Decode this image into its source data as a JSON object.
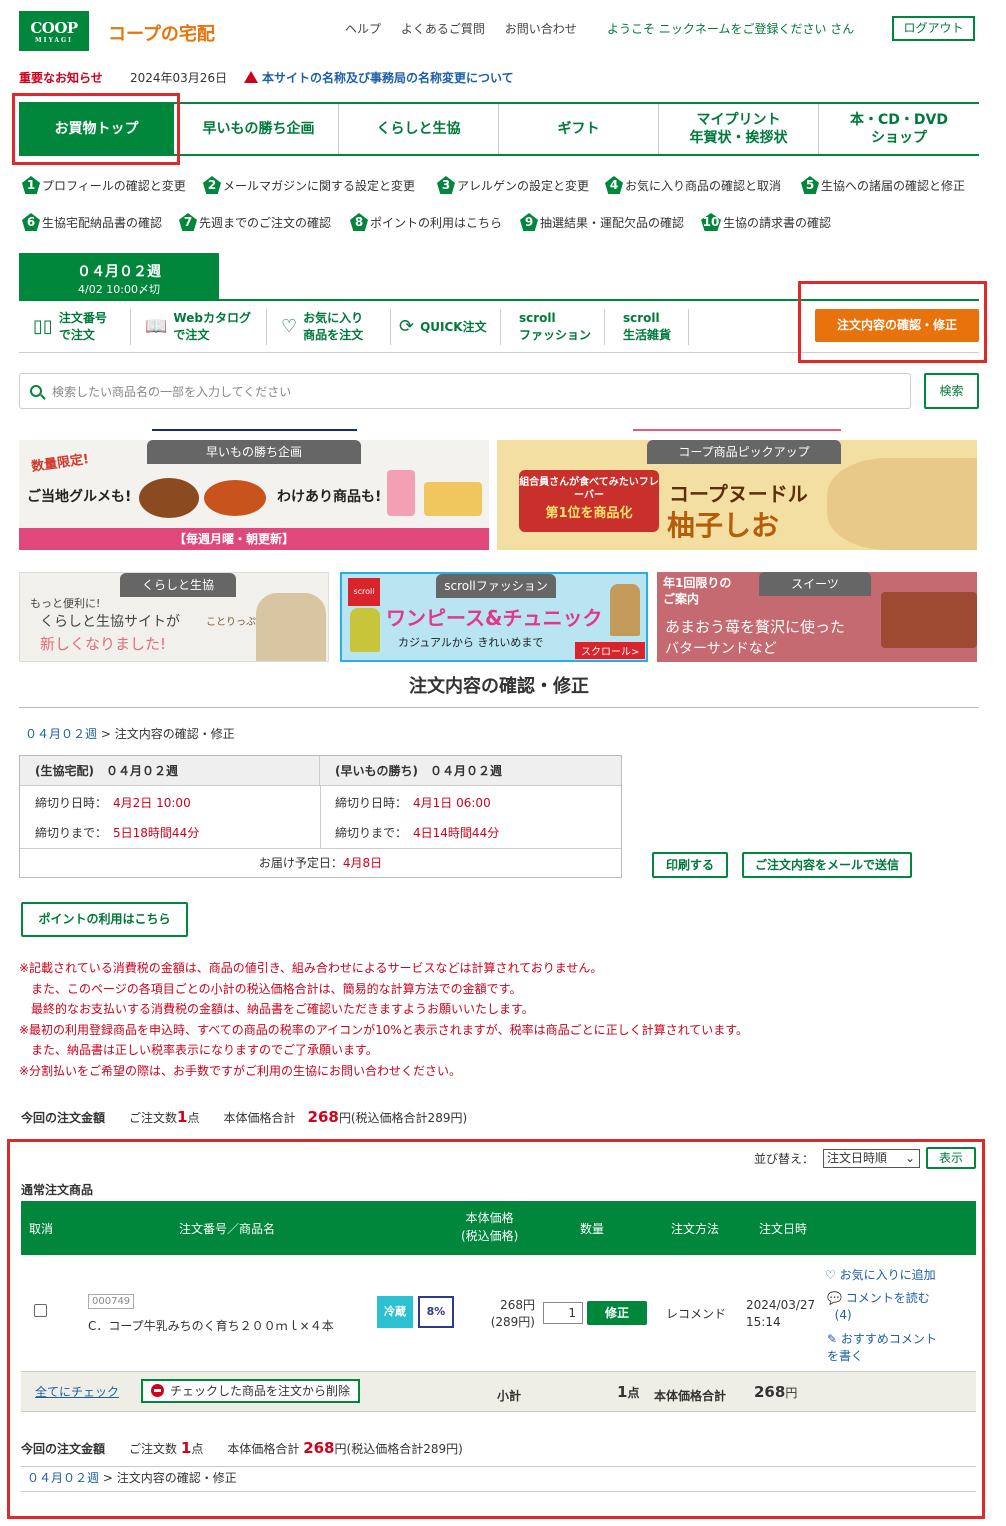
{
  "header": {
    "logo": "COOP",
    "logo_sub": "MIYAGI",
    "brand": "コープの宅配",
    "links": [
      "ヘルプ",
      "よくあるご質問",
      "お問い合わせ"
    ],
    "welcome": "ようこそ ニックネームをご登録ください さん",
    "logout": "ログアウト"
  },
  "notice": {
    "label": "重要なお知らせ",
    "date": "2024年03月26日",
    "link": "本サイトの名称及び事務局の名称変更について"
  },
  "nav": [
    {
      "label": "お買物トップ",
      "active": true
    },
    {
      "label": "早いもの勝ち企画"
    },
    {
      "label": "くらしと生協"
    },
    {
      "label": "ギフト"
    },
    {
      "label": "マイプリント",
      "label2": "年賀状・挨拶状"
    },
    {
      "label": "本・CD・DVD",
      "label2": "ショップ"
    }
  ],
  "profile_links": [
    {
      "n": "1",
      "label": "プロフィールの確認と変更"
    },
    {
      "n": "2",
      "label": "メールマガジンに関する設定と変更"
    },
    {
      "n": "3",
      "label": "アレルゲンの設定と変更"
    },
    {
      "n": "4",
      "label": "お気に入り商品の確認と取消"
    },
    {
      "n": "5",
      "label": "生協への諸届の確認と修正"
    },
    {
      "n": "6",
      "label": "生協宅配納品書の確認"
    },
    {
      "n": "7",
      "label": "先週までのご注文の確認"
    },
    {
      "n": "8",
      "label": "ポイントの利用はこちら"
    },
    {
      "n": "9",
      "label": "抽選結果・運配欠品の確認"
    },
    {
      "n": "10",
      "label": "生協の請求書の確認"
    }
  ],
  "week": {
    "title": "０４月０２週",
    "deadline": "4/02 10:00〆切"
  },
  "subnav": [
    {
      "icon": "book-icon",
      "label": "注文番号",
      "label2": "で注文"
    },
    {
      "icon": "catalog-icon",
      "label": "Webカタログ",
      "label2": "で注文"
    },
    {
      "icon": "heart-icon",
      "label": "お気に入り",
      "label2": "商品を注文"
    },
    {
      "icon": "refresh-icon",
      "label": "QUICK注文",
      "label2": ""
    },
    {
      "icon": "",
      "label": "scroll",
      "label2": "ファッション"
    },
    {
      "icon": "",
      "label": "scroll",
      "label2": "生活雑貨"
    }
  ],
  "order_check_button": "注文内容の確認・修正",
  "search": {
    "placeholder": "検索したい商品名の一部を入力してください",
    "button": "検索"
  },
  "banners": {
    "b1": {
      "tag": "早いもの勝ち企画",
      "t1": "数量限定!",
      "t2": "ご当地グルメも!",
      "t3": "わけあり商品も!",
      "foot": "【毎週月曜・朝更新】"
    },
    "b2": {
      "tag": "コープ商品ピックアップ",
      "t1": "組合員さんが食べてみたいフレーバー",
      "t2": "第1位を商品化",
      "t3": "コープヌードル",
      "t4": "柚子しお"
    },
    "b3": {
      "tag": "くらしと生協",
      "t1": "もっと便利に!",
      "t2": "くらしと生協サイトが",
      "t3": "新しくなりました!",
      "t4": "ことりっぷコラボ"
    },
    "b4": {
      "tag": "scrollファッション",
      "t1": "ワンピース&チュニック",
      "t2": "カジュアルから きれいめまで",
      "t3": "スクロール>"
    },
    "b5": {
      "tag": "スイーツ",
      "t1": "年1回限りの",
      "t2": "ご案内",
      "t3": "あまおう苺を贅沢に使った",
      "t4": "バターサンドなど"
    }
  },
  "page_title": "注文内容の確認・修正",
  "breadcrumb": {
    "week": "０４月０２週",
    "sep": " > ",
    "current": "注文内容の確認・修正"
  },
  "order_summary": {
    "left": {
      "head": "(生協宅配)　０４月０２週",
      "l1": "締切り日時：",
      "v1": "4月2日 10:00",
      "l2": "締切りまで：",
      "v2": "5日18時間44分"
    },
    "right": {
      "head": "(早いもの勝ち)　０４月０２週",
      "l1": "締切り日時：",
      "v1": "4月1日 06:00",
      "l2": "締切りまで：",
      "v2": "4日14時間44分"
    },
    "delivery_label": "お届け予定日：",
    "delivery_value": "4月8日"
  },
  "print_button": "印刷する",
  "mail_button": "ご注文内容をメールで送信",
  "points_button": "ポイントの利用はこちら",
  "notes": [
    "※記載されている消費税の金額は、商品の値引き、組み合わせによるサービスなどは計算されておりません。",
    "　また、このページの各項目ごとの小計の税込価格合計は、簡易的な計算方法での金額です。",
    "　最終的なお支払いする消費税の金額は、納品書をご確認いただきますようお願いいたします。",
    "※最初の利用登録商品を申込時、すべての商品の税率のアイコンが10%と表示されますが、税率は商品ごとに正しく計算されています。",
    "　また、納品書は正しい税率表示になりますのでご了承願います。",
    "※分割払いをご希望の際は、お手数ですがご利用の生協にお問い合わせください。"
  ],
  "total": {
    "label": "今回の注文金額",
    "count_label": "ご注文数",
    "count": "1",
    "count_unit": "点",
    "price_label": "本体価格合計",
    "price": "268",
    "price_unit": "円",
    "tax_note": "(税込価格合計289円)"
  },
  "sort": {
    "label": "並び替え：",
    "selected": "注文日時順",
    "button": "表示"
  },
  "section_title": "通常注文商品",
  "table": {
    "headers": {
      "cancel": "取消",
      "name": "注文番号／商品名",
      "price": "本体価格",
      "price2": "(税込価格)",
      "qty": "数量",
      "method": "注文方法",
      "date": "注文日時"
    },
    "rows": [
      {
        "code": "000749",
        "name": "C．コープ牛乳みちのく育ち２００ｍｌ×４本",
        "tag_cold": "冷蔵",
        "tag_tax": "8%",
        "price": "268円",
        "price_tax": "(289円)",
        "qty": "1",
        "fix": "修正",
        "method": "レコメンド",
        "date": "2024/03/27",
        "time": "15:14",
        "fav": "お気に入りに追加",
        "comment": "コメントを読む",
        "comment_count": "(4)",
        "recommend1": "おすすめコメント",
        "recommend2": "を書く"
      }
    ],
    "check_all": "全てにチェック",
    "delete_checked": "チェックした商品を注文から削除",
    "subtotal_label": "小計",
    "subtotal_count": "1",
    "subtotal_unit": "点",
    "subtotal_price_label": "本体価格合計",
    "subtotal_price": "268",
    "subtotal_price_unit": "円"
  }
}
